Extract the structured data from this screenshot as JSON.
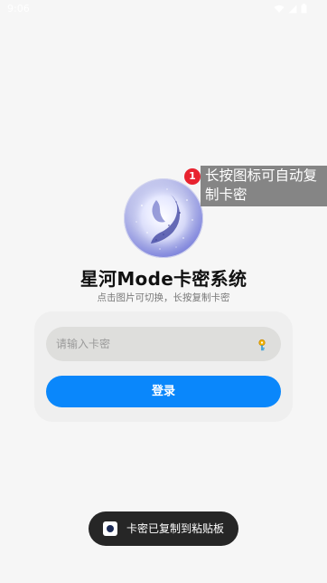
{
  "status_bar": {
    "time": "9:06",
    "icons": [
      "wifi-icon",
      "signal-icon",
      "battery-icon"
    ]
  },
  "logo": {
    "icon": "galaxy-logo-icon",
    "badge_count": "1"
  },
  "tooltip": {
    "text": "长按图标可自动复制卡密"
  },
  "header": {
    "title": "星河Mode卡密系统",
    "subtitle": "点击图片可切换，长按复制卡密"
  },
  "form": {
    "card_key_placeholder": "请输入卡密",
    "card_key_value": "",
    "key_icon": "key-icon",
    "login_label": "登录"
  },
  "toast": {
    "icon": "app-icon",
    "message": "卡密已复制到粘贴板"
  },
  "colors": {
    "accent": "#0a87fb",
    "badge": "#e8232f",
    "background": "#f6f6f6",
    "toast_bg": "#262626"
  }
}
